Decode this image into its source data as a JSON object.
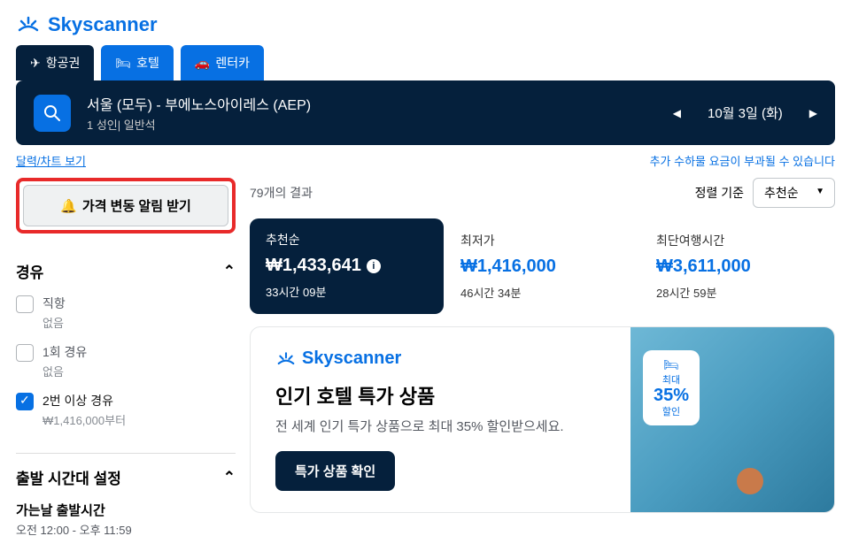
{
  "brand": "Skyscanner",
  "tabs": {
    "flights": "항공권",
    "hotels": "호텔",
    "cars": "렌터카"
  },
  "search": {
    "route": "서울 (모두) - 부에노스아이레스 (AEP)",
    "passengers": "1 성인| 일반석",
    "date": "10월 3일 (화)"
  },
  "links": {
    "chart": "달력/차트 보기",
    "baggage": "추가 수하물 요금이 부과될 수 있습니다"
  },
  "priceAlert": "가격 변동 알림 받기",
  "resultCount": "79개의 결과",
  "sort": {
    "label": "정렬 기준",
    "value": "추천순"
  },
  "filters": {
    "stops": {
      "title": "경유",
      "direct": {
        "label": "직항",
        "sub": "없음"
      },
      "oneStop": {
        "label": "1회 경유",
        "sub": "없음"
      },
      "twoPlus": {
        "label": "2번 이상 경유",
        "sub": "₩1,416,000부터"
      }
    },
    "departTime": {
      "title": "출발 시간대 설정",
      "goLabel": "가는날 출발시간",
      "goRange": "오전 12:00 - 오후 11:59"
    }
  },
  "summary": {
    "recommended": {
      "title": "추천순",
      "price": "₩1,433,641",
      "time": "33시간 09분"
    },
    "cheapest": {
      "title": "최저가",
      "price": "₩1,416,000",
      "time": "46시간 34분"
    },
    "fastest": {
      "title": "최단여행시간",
      "price": "₩3,611,000",
      "time": "28시간 59분"
    }
  },
  "promo": {
    "brand": "Skyscanner",
    "title": "인기 호텔 특가 상품",
    "desc": "전 세계 인기 특가 상품으로 최대 35% 할인받으세요.",
    "button": "특가 상품 확인",
    "badge": {
      "top": "최대",
      "pct": "35%",
      "bot": "할인"
    }
  }
}
